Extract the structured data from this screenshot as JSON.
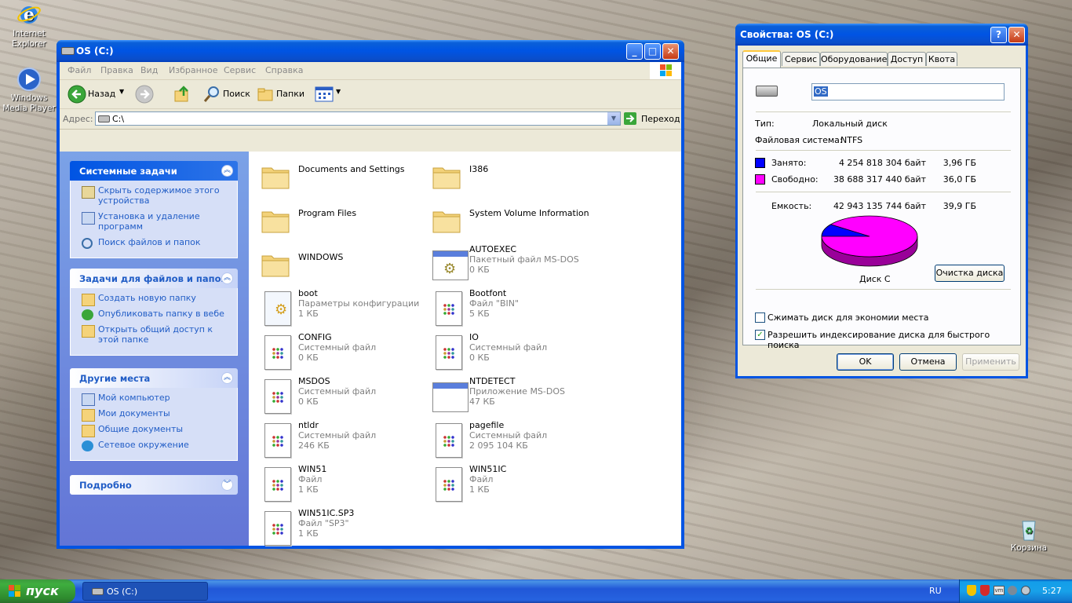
{
  "desktop": {
    "icons": [
      {
        "label": "Internet Explorer"
      },
      {
        "label": "Windows Media Player"
      },
      {
        "label": "Корзина"
      }
    ]
  },
  "explorer": {
    "title": "OS (C:)",
    "menu": [
      "Файл",
      "Правка",
      "Вид",
      "Избранное",
      "Сервис",
      "Справка"
    ],
    "toolbar": {
      "back": "Назад",
      "search": "Поиск",
      "folders": "Папки"
    },
    "address": {
      "label": "Адрес:",
      "value": "C:\\",
      "go": "Переход"
    },
    "panels": {
      "system": {
        "title": "Системные задачи",
        "links": [
          "Скрыть содержимое этого устройства",
          "Установка и удаление программ",
          "Поиск файлов и папок"
        ]
      },
      "files": {
        "title": "Задачи для файлов и папок",
        "links": [
          "Создать новую папку",
          "Опубликовать папку в вебе",
          "Открыть общий доступ к этой папке"
        ]
      },
      "places": {
        "title": "Другие места",
        "links": [
          "Мой компьютер",
          "Мои документы",
          "Общие документы",
          "Сетевое окружение"
        ]
      },
      "details": {
        "title": "Подробно"
      }
    },
    "files": [
      {
        "name": "Documents and Settings"
      },
      {
        "name": "I386"
      },
      {
        "name": "Program Files"
      },
      {
        "name": "System Volume Information"
      },
      {
        "name": "WINDOWS"
      },
      {
        "name": "AUTOEXEC",
        "type": "Пакетный файл MS-DOS",
        "size": "0 КБ"
      },
      {
        "name": "boot",
        "type": "Параметры конфигурации",
        "size": "1 КБ"
      },
      {
        "name": "Bootfont",
        "type": "Файл \"BIN\"",
        "size": "5 КБ"
      },
      {
        "name": "CONFIG",
        "type": "Системный файл",
        "size": "0 КБ"
      },
      {
        "name": "IO",
        "type": "Системный файл",
        "size": "0 КБ"
      },
      {
        "name": "MSDOS",
        "type": "Системный файл",
        "size": "0 КБ"
      },
      {
        "name": "NTDETECT",
        "type": "Приложение MS-DOS",
        "size": "47 КБ"
      },
      {
        "name": "ntldr",
        "type": "Системный файл",
        "size": "246 КБ"
      },
      {
        "name": "pagefile",
        "type": "Системный файл",
        "size": "2 095 104 КБ"
      },
      {
        "name": "WIN51",
        "type": "Файл",
        "size": "1 КБ"
      },
      {
        "name": "WIN51IC",
        "type": "Файл",
        "size": "1 КБ"
      },
      {
        "name": "WIN51IC.SP3",
        "type": "Файл \"SP3\"",
        "size": "1 КБ"
      }
    ]
  },
  "props": {
    "title": "Свойства: OS (C:)",
    "tabs": [
      "Общие",
      "Сервис",
      "Оборудование",
      "Доступ",
      "Квота"
    ],
    "label_value": "OS",
    "type_label": "Тип:",
    "type_value": "Локальный диск",
    "fs_label": "Файловая система:",
    "fs_value": "NTFS",
    "used_label": "Занято:",
    "used_bytes": "4 254 818 304 байт",
    "used_gb": "3,96 ГБ",
    "free_label": "Свободно:",
    "free_bytes": "38 688 317 440 байт",
    "free_gb": "36,0 ГБ",
    "cap_label": "Емкость:",
    "cap_bytes": "42 943 135 744 байт",
    "cap_gb": "39,9 ГБ",
    "disk_label": "Диск C",
    "cleanup": "Очистка диска",
    "compress": "Сжимать диск для экономии места",
    "index": "Разрешить индексирование диска для быстрого поиска",
    "ok": "OK",
    "cancel": "Отмена",
    "apply": "Применить",
    "used_fraction": 0.099,
    "colors": {
      "used": "#0000ff",
      "free": "#ff00ff"
    }
  },
  "taskbar": {
    "start": "пуск",
    "task": "OS (C:)",
    "lang": "RU",
    "clock": "5:27"
  }
}
